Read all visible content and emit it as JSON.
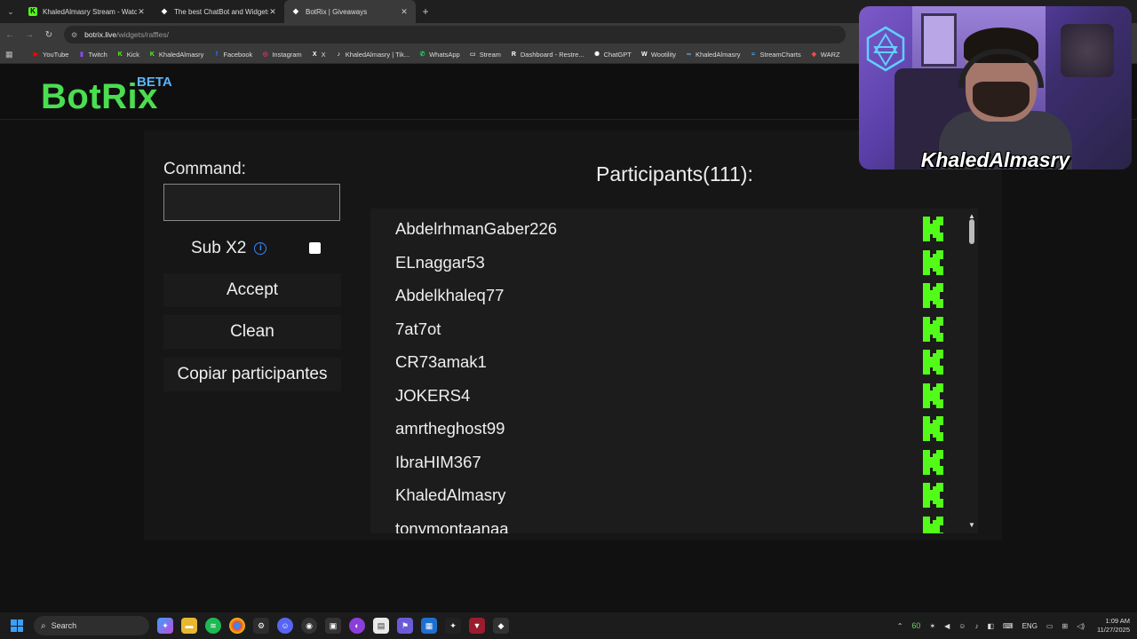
{
  "browser": {
    "tabs": [
      {
        "label": "KhaledAlmasry Stream - Watch",
        "favicon": "kick-icon",
        "color": "#53fc18"
      },
      {
        "label": "The best ChatBot and Widgets",
        "favicon": "botrix-icon",
        "color": "#ffffff"
      },
      {
        "label": "BotRix | Giveaways",
        "favicon": "botrix-icon",
        "color": "#ffffff"
      }
    ],
    "url_host": "botrix.live",
    "url_path": "/widgets/raffles/",
    "bookmarks": [
      {
        "label": "YouTube",
        "icon": "youtube-icon",
        "color": "#ff0000"
      },
      {
        "label": "Twitch",
        "icon": "twitch-icon",
        "color": "#9146ff"
      },
      {
        "label": "Kick",
        "icon": "kick-icon",
        "color": "#53fc18"
      },
      {
        "label": "KhaledAlmasry",
        "icon": "kick-icon",
        "color": "#53fc18"
      },
      {
        "label": "Facebook",
        "icon": "facebook-icon",
        "color": "#1877f2"
      },
      {
        "label": "Instagram",
        "icon": "instagram-icon",
        "color": "#e1306c"
      },
      {
        "label": "X",
        "icon": "x-icon",
        "color": "#ffffff"
      },
      {
        "label": "KhaledAlmasry | Tik...",
        "icon": "tiktok-icon",
        "color": "#ffffff"
      },
      {
        "label": "WhatsApp",
        "icon": "whatsapp-icon",
        "color": "#25d366"
      },
      {
        "label": "Stream",
        "icon": "folder-icon",
        "color": "#cccccc"
      },
      {
        "label": "Dashboard - Restre...",
        "icon": "restream-icon",
        "color": "#ffffff"
      },
      {
        "label": "ChatGPT",
        "icon": "chatgpt-icon",
        "color": "#ffffff"
      },
      {
        "label": "Wootility",
        "icon": "wootility-icon",
        "color": "#ffffff"
      },
      {
        "label": "KhaledAlmasry",
        "icon": "meta-icon",
        "color": "#5ab4ff"
      },
      {
        "label": "StreamCharts",
        "icon": "streamcharts-icon",
        "color": "#5ab4ff"
      },
      {
        "label": "WARZ",
        "icon": "warzone-icon",
        "color": "#ff4d4d"
      }
    ]
  },
  "site": {
    "logo": "BotRix",
    "logo_badge": "BETA"
  },
  "form": {
    "command_label": "Command:",
    "command_value": "",
    "sub_label": "Sub X2",
    "sub_checked": false,
    "accept_label": "Accept",
    "clean_label": "Clean",
    "copy_label": "Copiar participantes"
  },
  "participants": {
    "title": "Participants(111):",
    "platform_icon": "kick-icon",
    "items": [
      "AbdelrhmanGaber226",
      "ELnaggar53",
      "Abdelkhaleq77",
      "7at7ot",
      "CR73amak1",
      "JOKERS4",
      "amrtheghost99",
      "IbraHIM367",
      "KhaledAlmasry",
      "tonymontaanaa"
    ]
  },
  "webcam": {
    "name": "KhaledAlmasry"
  },
  "taskbar": {
    "search_label": "Search",
    "fps": "60",
    "lang": "ENG",
    "time": "1:09 AM",
    "date": "11/27/2025"
  },
  "colors": {
    "accent": "#4ade50",
    "kick_green": "#53fc18",
    "beta_blue": "#5ab4ff"
  }
}
